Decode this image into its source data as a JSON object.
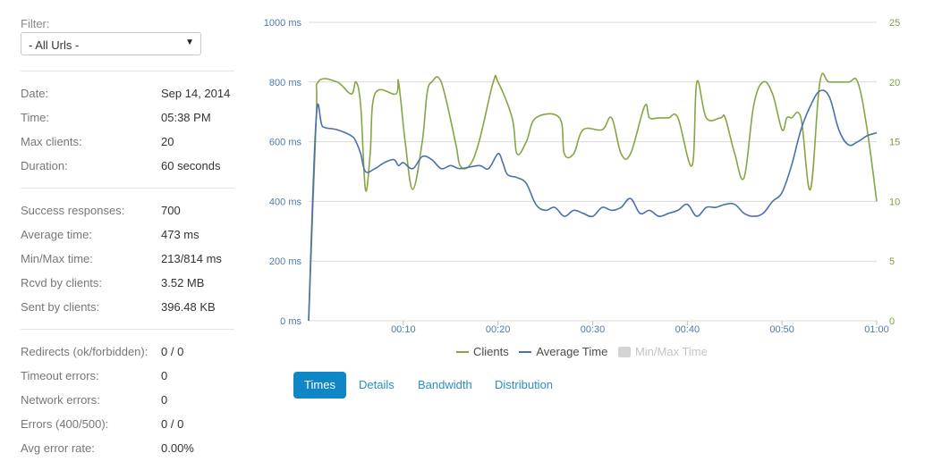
{
  "filter": {
    "label": "Filter:",
    "selected": "- All Urls -"
  },
  "summary": [
    {
      "label": "Date:",
      "value": "Sep 14, 2014"
    },
    {
      "label": "Time:",
      "value": "05:38 PM"
    },
    {
      "label": "Max clients:",
      "value": "20"
    },
    {
      "label": "Duration:",
      "value": "60 seconds"
    }
  ],
  "responses": [
    {
      "label": "Success responses:",
      "value": "700"
    },
    {
      "label": "Average time:",
      "value": "473 ms"
    },
    {
      "label": "Min/Max time:",
      "value": "213/814 ms"
    },
    {
      "label": "Rcvd by clients:",
      "value": "3.52 MB"
    },
    {
      "label": "Sent by clients:",
      "value": "396.48 KB"
    }
  ],
  "errors": [
    {
      "label": "Redirects (ok/forbidden):",
      "value": "0 / 0"
    },
    {
      "label": "Timeout errors:",
      "value": "0"
    },
    {
      "label": "Network errors:",
      "value": "0"
    },
    {
      "label": "Errors (400/500):",
      "value": "0 / 0"
    },
    {
      "label": "Avg error rate:",
      "value": "0.00%"
    }
  ],
  "tabs": [
    {
      "label": "Times",
      "active": true
    },
    {
      "label": "Details",
      "active": false
    },
    {
      "label": "Bandwidth",
      "active": false
    },
    {
      "label": "Distribution",
      "active": false
    }
  ],
  "colors": {
    "average_time": "#4a72a8",
    "clients": "#86a544",
    "minmax": "#d4d4d4",
    "grid": "#d9d9d9",
    "tab_active": "#0f87c6"
  },
  "chart_data": {
    "type": "line",
    "x_ticks": [
      "00:10",
      "00:20",
      "00:30",
      "00:40",
      "00:50",
      "01:00"
    ],
    "x_tick_seconds": [
      10,
      20,
      30,
      40,
      50,
      60
    ],
    "xlim": [
      0,
      60
    ],
    "y_left": {
      "ticks": [
        "0 ms",
        "200 ms",
        "400 ms",
        "600 ms",
        "800 ms",
        "1000 ms"
      ],
      "range": [
        0,
        1000
      ]
    },
    "y_right": {
      "ticks": [
        "0",
        "5",
        "10",
        "15",
        "20",
        "25"
      ],
      "range": [
        0,
        25
      ]
    },
    "grid": true,
    "legend_position": "bottom",
    "series": [
      {
        "name": "Clients",
        "axis": "right",
        "x": [
          0,
          0.8,
          1,
          3,
          4.5,
          5,
          5.5,
          6,
          6.5,
          7,
          9.2,
          9.5,
          10.2,
          11,
          12,
          12.5,
          13,
          14,
          15.5,
          16,
          17,
          18,
          19.5,
          20,
          21.5,
          22,
          23,
          24,
          26.5,
          27,
          28,
          29,
          31,
          32,
          33,
          34,
          35.5,
          36,
          37,
          38,
          39,
          40.5,
          41,
          42,
          43.5,
          44,
          45,
          46,
          47,
          48,
          49,
          50,
          50.5,
          51,
          52,
          53,
          54,
          55,
          57,
          58,
          59,
          60
        ],
        "y": [
          0,
          17,
          20,
          20,
          19,
          20,
          18,
          11,
          14,
          19,
          19,
          20,
          15,
          11,
          15,
          19,
          20,
          20,
          15,
          13,
          13,
          15,
          20,
          20,
          17,
          14,
          15,
          17,
          17,
          14,
          14,
          16,
          16,
          17,
          14,
          14,
          18,
          17,
          17,
          17,
          17,
          13,
          20,
          17,
          17,
          17,
          14,
          12,
          18,
          20,
          19,
          16,
          17,
          17,
          17,
          11,
          20,
          20,
          20,
          20,
          16,
          10
        ]
      },
      {
        "name": "Average Time",
        "axis": "left",
        "x": [
          0,
          0.8,
          1.5,
          3,
          4.5,
          5,
          5.5,
          6,
          7,
          8,
          9,
          9.5,
          10,
          11,
          12,
          13,
          14,
          15,
          16,
          18,
          19,
          20,
          20.5,
          21,
          22,
          23,
          24,
          25,
          26,
          27,
          28,
          29,
          30,
          31,
          32,
          33,
          34,
          35,
          36,
          37,
          38,
          39,
          40,
          41,
          42,
          43,
          44,
          45,
          46,
          47,
          48,
          49,
          50,
          51,
          52,
          53,
          54,
          55,
          56,
          57,
          58,
          59,
          60
        ],
        "y": [
          0,
          680,
          650,
          640,
          620,
          600,
          560,
          500,
          510,
          530,
          540,
          520,
          530,
          510,
          550,
          540,
          510,
          520,
          510,
          520,
          510,
          560,
          530,
          490,
          480,
          460,
          390,
          370,
          380,
          350,
          370,
          360,
          350,
          380,
          370,
          380,
          410,
          360,
          370,
          350,
          360,
          370,
          390,
          350,
          380,
          380,
          390,
          390,
          360,
          350,
          360,
          400,
          430,
          520,
          640,
          720,
          770,
          750,
          640,
          590,
          600,
          620,
          630
        ]
      }
    ],
    "hidden_series": [
      {
        "name": "Min/Max Time"
      }
    ]
  }
}
